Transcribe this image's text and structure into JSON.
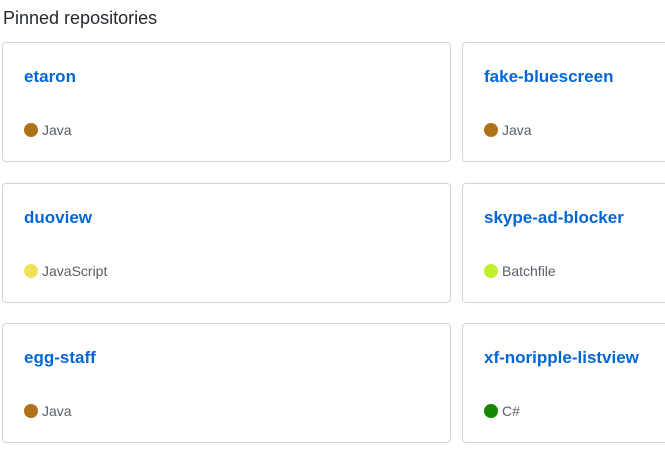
{
  "section": {
    "title": "Pinned repositories"
  },
  "repos": [
    {
      "name": "etaron",
      "language": "Java",
      "language_color": "#b07219"
    },
    {
      "name": "fake-bluescreen",
      "language": "Java",
      "language_color": "#b07219"
    },
    {
      "name": "duoview",
      "language": "JavaScript",
      "language_color": "#f1e05a"
    },
    {
      "name": "skype-ad-blocker",
      "language": "Batchfile",
      "language_color": "#c1f12e"
    },
    {
      "name": "egg-staff",
      "language": "Java",
      "language_color": "#b07219"
    },
    {
      "name": "xf-noripple-listview",
      "language": "C#",
      "language_color": "#178600"
    }
  ]
}
